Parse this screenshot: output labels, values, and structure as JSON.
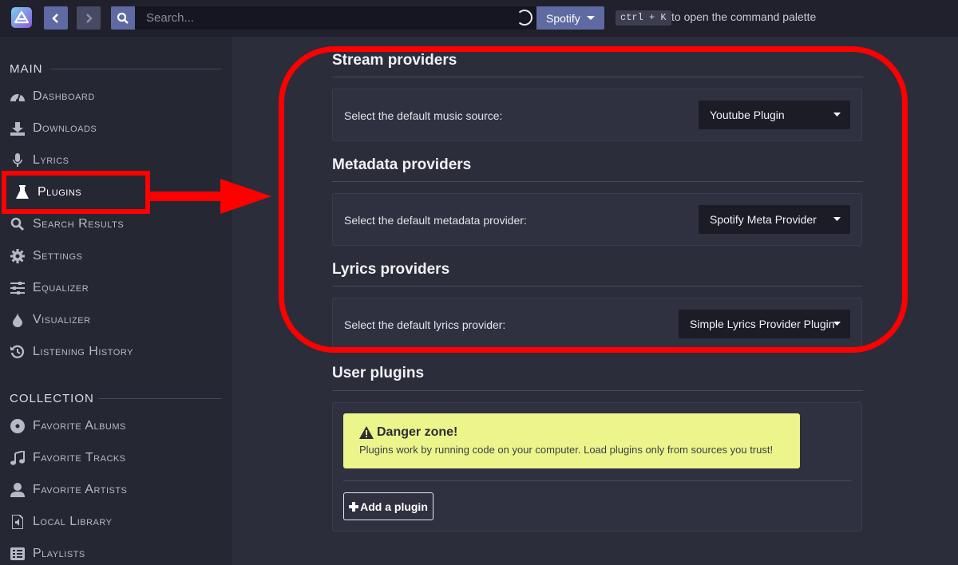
{
  "topbar": {
    "search_placeholder": "Search...",
    "provider_label": "Spotify",
    "shortcut": "ctrl + K",
    "shortcut_hint": "to open the command palette"
  },
  "sidebar": {
    "main_title": "MAIN",
    "main_items": [
      {
        "label": "Dashboard",
        "icon": "dashboard-icon"
      },
      {
        "label": "Downloads",
        "icon": "download-icon"
      },
      {
        "label": "Lyrics",
        "icon": "microphone-icon"
      },
      {
        "label": "Plugins",
        "icon": "flask-icon",
        "active": true
      },
      {
        "label": "Search Results",
        "icon": "search-icon"
      },
      {
        "label": "Settings",
        "icon": "gear-icon"
      },
      {
        "label": "Equalizer",
        "icon": "sliders-icon"
      },
      {
        "label": "Visualizer",
        "icon": "drop-icon"
      },
      {
        "label": "Listening History",
        "icon": "history-icon"
      }
    ],
    "collection_title": "COLLECTION",
    "collection_items": [
      {
        "label": "Favorite Albums",
        "icon": "disc-icon"
      },
      {
        "label": "Favorite Tracks",
        "icon": "music-note-icon"
      },
      {
        "label": "Favorite Artists",
        "icon": "user-icon"
      },
      {
        "label": "Local Library",
        "icon": "file-audio-icon"
      },
      {
        "label": "Playlists",
        "icon": "list-icon"
      }
    ]
  },
  "content": {
    "stream": {
      "title": "Stream providers",
      "label": "Select the default music source:",
      "value": "Youtube Plugin"
    },
    "metadata": {
      "title": "Metadata providers",
      "label": "Select the default metadata provider:",
      "value": "Spotify Meta Provider"
    },
    "lyrics": {
      "title": "Lyrics providers",
      "label": "Select the default lyrics provider:",
      "value": "Simple Lyrics Provider Plugin"
    },
    "user_plugins": {
      "title": "User plugins",
      "danger_title": "Danger zone!",
      "danger_text": "Plugins work by running code on your computer. Load plugins only from sources you trust!",
      "add_button": "Add a plugin"
    }
  },
  "colors": {
    "accent": "#5f6aa3",
    "annotation": "#ff0000",
    "warning_bg": "#ecf58b"
  }
}
